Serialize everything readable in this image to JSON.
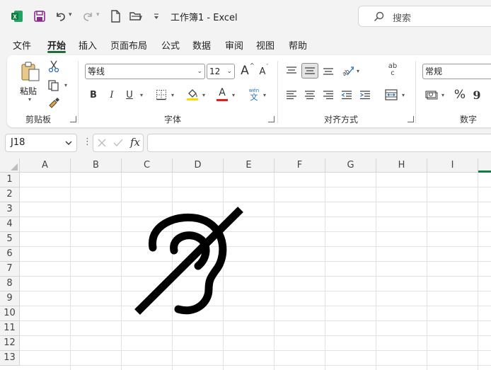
{
  "titlebar": {
    "doc_title": "工作簿1  -  Excel",
    "search_placeholder": "搜索",
    "icons": [
      "excel-logo-icon",
      "save-icon",
      "undo-icon",
      "redo-icon",
      "new-file-icon",
      "open-folder-icon",
      "customize-icon",
      "search-icon"
    ]
  },
  "menu": {
    "tabs": [
      "文件",
      "开始",
      "插入",
      "页面布局",
      "公式",
      "数据",
      "审阅",
      "视图",
      "帮助"
    ],
    "active": "开始"
  },
  "ribbon": {
    "clipboard": {
      "paste_label": "粘贴",
      "group_label": "剪贴板"
    },
    "font": {
      "font_name": "等线",
      "font_size": "12",
      "group_label": "字体",
      "bold": "B",
      "italic": "I",
      "underline": "U",
      "grow": "A",
      "shrink": "A",
      "font_color_letter": "A",
      "phonetic_top": "wén",
      "phonetic_bottom": "文",
      "fill_color": "#ffd800",
      "font_color": "#e0201a"
    },
    "alignment": {
      "group_label": "对齐方式",
      "wrap_top": "ab",
      "wrap_bottom": "c"
    },
    "number": {
      "format": "常规",
      "group_label": "数字",
      "percent": "%",
      "comma": "9"
    }
  },
  "formula_bar": {
    "name_box": "J18",
    "fx_label": "fx",
    "formula_value": ""
  },
  "grid": {
    "columns": [
      "A",
      "B",
      "C",
      "D",
      "E",
      "F",
      "G",
      "H",
      "I"
    ],
    "rows": [
      "1",
      "2",
      "3",
      "4",
      "5",
      "6",
      "7",
      "8",
      "9",
      "10",
      "11",
      "12",
      "13"
    ]
  },
  "picture": {
    "icon": "hearing-impaired-icon",
    "color": "#000000"
  },
  "colors": {
    "accent": "#1e6e3c",
    "excel_green": "#107c41"
  }
}
